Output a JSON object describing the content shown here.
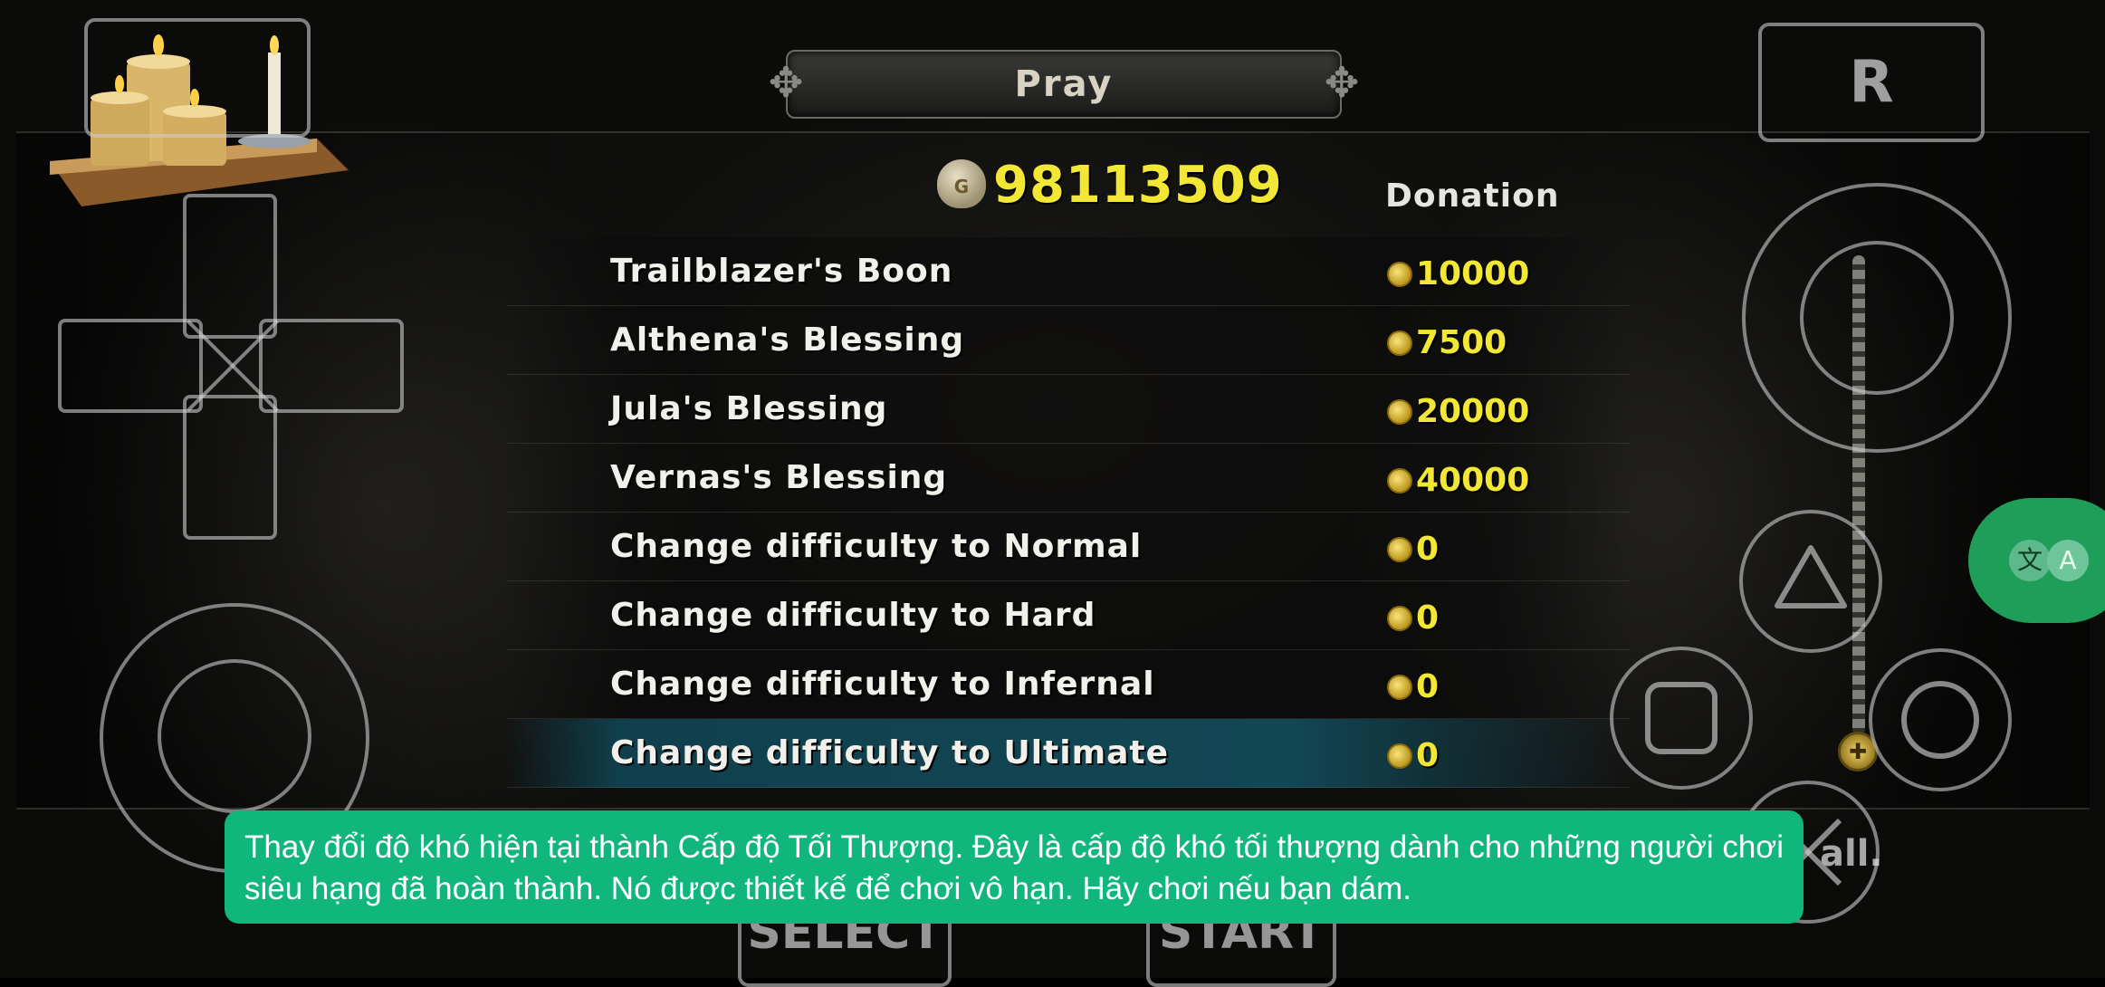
{
  "menu": {
    "title": "Pray",
    "gold_icon_glyph": "G",
    "gold": "98113509",
    "column_header": "Donation",
    "items": [
      {
        "name": "Trailblazer's Boon",
        "cost": "10000",
        "selected": false
      },
      {
        "name": "Althena's Blessing",
        "cost": "7500",
        "selected": false
      },
      {
        "name": "Jula's Blessing",
        "cost": "20000",
        "selected": false
      },
      {
        "name": "Vernas's Blessing",
        "cost": "40000",
        "selected": false
      },
      {
        "name": "Change difficulty to Normal",
        "cost": "0",
        "selected": false
      },
      {
        "name": "Change difficulty to Hard",
        "cost": "0",
        "selected": false
      },
      {
        "name": "Change difficulty to Infernal",
        "cost": "0",
        "selected": false
      },
      {
        "name": "Change difficulty to Ultimate",
        "cost": "0",
        "selected": true
      }
    ]
  },
  "controls": {
    "r_button": "R",
    "select_button": "SELECT",
    "start_button": "START",
    "partial_text": "all."
  },
  "translate": {
    "glyph_source": "文",
    "glyph_target": "A"
  },
  "toast": {
    "text": "Thay đổi độ khó hiện tại thành Cấp độ Tối Thượng. Đây là cấp độ khó tối thượng dành cho những người chơi siêu hạng đã hoàn thành. Nó được thiết kế để chơi vô hạn. Hãy chơi nếu bạn dám."
  },
  "colors": {
    "gold_text": "#f3e735",
    "selected_row": "#124a58",
    "toast_bg": "#11b67c",
    "translate_bg": "#1f9e5a"
  }
}
